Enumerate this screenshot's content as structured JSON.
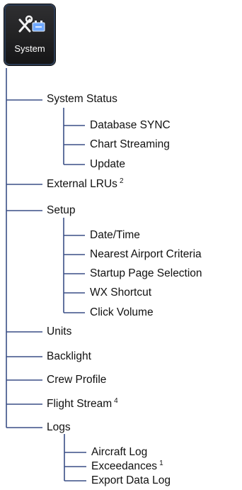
{
  "system_button": {
    "label": "System",
    "icon": "wrench-screwdriver-battery-icon"
  },
  "line_color": "#3a4f86",
  "menu": {
    "system_status": {
      "label": "System Status",
      "children": [
        "Database SYNC",
        "Chart Streaming",
        "Update"
      ]
    },
    "external_lrus": {
      "label": "External LRUs",
      "note": "2"
    },
    "setup": {
      "label": "Setup",
      "children": [
        "Date/Time",
        "Nearest Airport Criteria",
        "Startup Page Selection",
        "WX Shortcut",
        "Click Volume"
      ]
    },
    "units": {
      "label": "Units"
    },
    "backlight": {
      "label": "Backlight"
    },
    "crew_profile": {
      "label": "Crew Profile"
    },
    "flight_stream": {
      "label": "Flight Stream",
      "note": "4"
    },
    "logs": {
      "label": "Logs",
      "children": [
        "Aircraft Log",
        "Exceedances",
        "Export Data Log"
      ],
      "exceedances_note": "1"
    }
  }
}
